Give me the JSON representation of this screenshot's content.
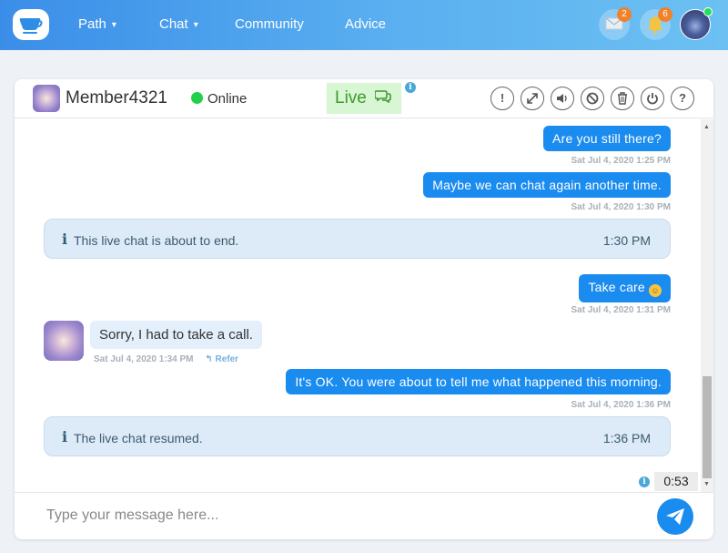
{
  "nav": {
    "items": [
      {
        "label": "Path",
        "has_caret": true
      },
      {
        "label": "Chat",
        "has_caret": true
      },
      {
        "label": "Community",
        "has_caret": false
      },
      {
        "label": "Advice",
        "has_caret": false
      }
    ],
    "caret": "▾",
    "mail_badge": "2",
    "bell_badge": "6",
    "logo_icon": "teacup-icon",
    "brand_color": "#3b8ee8"
  },
  "chat_header": {
    "member_name": "Member4321",
    "status": "Online",
    "status_color": "#21d04a",
    "live_label": "Live",
    "live_icon": "💬",
    "info_glyph": "i",
    "buttons": [
      {
        "name": "report-button",
        "glyph": "!"
      },
      {
        "name": "expand-button",
        "glyph": "⤢"
      },
      {
        "name": "sound-button",
        "glyph": "🔊"
      },
      {
        "name": "block-button",
        "glyph": "⊘"
      },
      {
        "name": "delete-button",
        "glyph": "🗑"
      },
      {
        "name": "power-button",
        "glyph": "⏻"
      },
      {
        "name": "help-button",
        "glyph": "?"
      }
    ]
  },
  "messages": {
    "out1": {
      "text": "Are you still there?",
      "time": "Sat Jul 4, 2020 1:25 PM"
    },
    "out2": {
      "text": "Maybe we can chat again another time.",
      "time": "Sat Jul 4, 2020 1:30 PM"
    },
    "sys1": {
      "text": "This live chat is about to end.",
      "time": "1:30 PM"
    },
    "out3": {
      "text": "Take care",
      "emoji": "☺",
      "time": "Sat Jul 4, 2020 1:31 PM"
    },
    "in1": {
      "text": "Sorry, I had to take a call.",
      "time": "Sat Jul 4, 2020 1:34 PM",
      "refer": "Refer",
      "refer_icon": "↰"
    },
    "out4": {
      "text": "It's OK. You were about to tell me what happened this morning.",
      "time": "Sat Jul 4, 2020 1:36 PM"
    },
    "sys2": {
      "text": "The live chat resumed.",
      "time": "1:36 PM"
    }
  },
  "timer": {
    "value": "0:53"
  },
  "composer": {
    "placeholder": "Type your message here..."
  },
  "scrollbar": {
    "up": "▲",
    "down": "▼"
  },
  "colors": {
    "outgoing_bubble": "#1a8bef",
    "incoming_bubble": "#e3effa",
    "system_bubble": "#dcebf7",
    "live_bg": "#d8f5d4"
  }
}
